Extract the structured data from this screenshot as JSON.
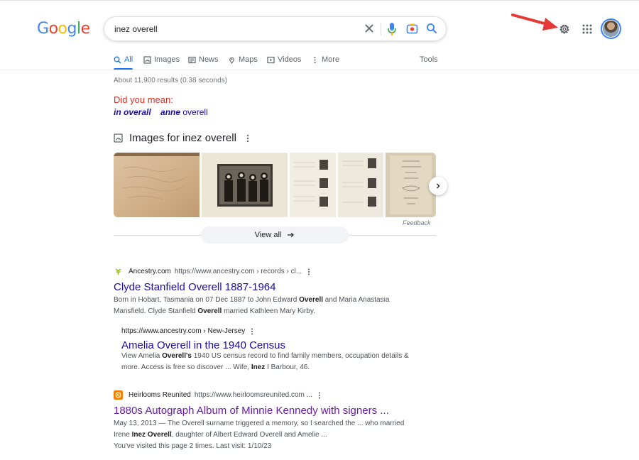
{
  "header": {
    "logo": [
      "G",
      "o",
      "o",
      "g",
      "l",
      "e"
    ],
    "logo_colors": [
      "#4285f4",
      "#ea4335",
      "#fbbc05",
      "#4285f4",
      "#34a853",
      "#ea4335"
    ],
    "query": "inez overell"
  },
  "tabs": [
    {
      "label": "All",
      "icon": "search-icon",
      "active": true
    },
    {
      "label": "Images",
      "icon": "image-icon"
    },
    {
      "label": "News",
      "icon": "news-icon"
    },
    {
      "label": "Maps",
      "icon": "map-pin-icon"
    },
    {
      "label": "Videos",
      "icon": "video-icon"
    },
    {
      "label": "More",
      "icon": "kebab-icon"
    }
  ],
  "tools_label": "Tools",
  "stats": "About 11,900 results (0.38 seconds)",
  "did_you_mean": {
    "label": "Did you mean:",
    "s1_bold": "in overall",
    "s2_bold": "anne",
    "s2_rest": " overell"
  },
  "images": {
    "heading": "Images for inez overell",
    "feedback": "Feedback",
    "view_all": "View all"
  },
  "results": [
    {
      "site": "Ancestry.com",
      "url": "https://www.ancestry.com › records › cl...",
      "title": "Clyde Stanfield Overell 1887-1964",
      "snippet_1": "Born in Hobart, Tasmania on 07 Dec 1887 to John Edward ",
      "snippet_1b": "Overell",
      "snippet_1c": " and Maria Anastasia",
      "snippet_2": "Mansfield. Clyde Stanfield ",
      "snippet_2b": "Overell",
      "snippet_2c": " married Kathleen Mary Kirby."
    },
    {
      "url": "https://www.ancestry.com › New-Jersey",
      "title": "Amelia Overell in the 1940 Census",
      "snippet_1": "View Amelia ",
      "snippet_1b": "Overell's",
      "snippet_1c": " 1940 US census record to find family members, occupation details &",
      "snippet_2": "more. Access is free so discover ... Wife, ",
      "snippet_2b": "Inez",
      "snippet_2c": " I Barbour, 46."
    },
    {
      "site": "Heirlooms Reunited",
      "url": "https://www.heirloomsreunited.com ...",
      "title": "1880s Autograph Album of Minnie Kennedy with signers ...",
      "snippet_1": "May 13, 2013 — The Overell surname triggered a memory, so I searched the ... who married",
      "snippet_2": "Irene ",
      "snippet_2b": "Inez Overell",
      "snippet_2c": ", daughter of Albert Edward Overell and Amelie ...",
      "visited": "You've visited this page 2 times. Last visit: 1/10/23"
    }
  ],
  "colors": {
    "link": "#1a0dab",
    "visited": "#681da8",
    "accent": "#1a73e8",
    "did_you_mean": "#d93025",
    "arrow": "#e53935"
  }
}
